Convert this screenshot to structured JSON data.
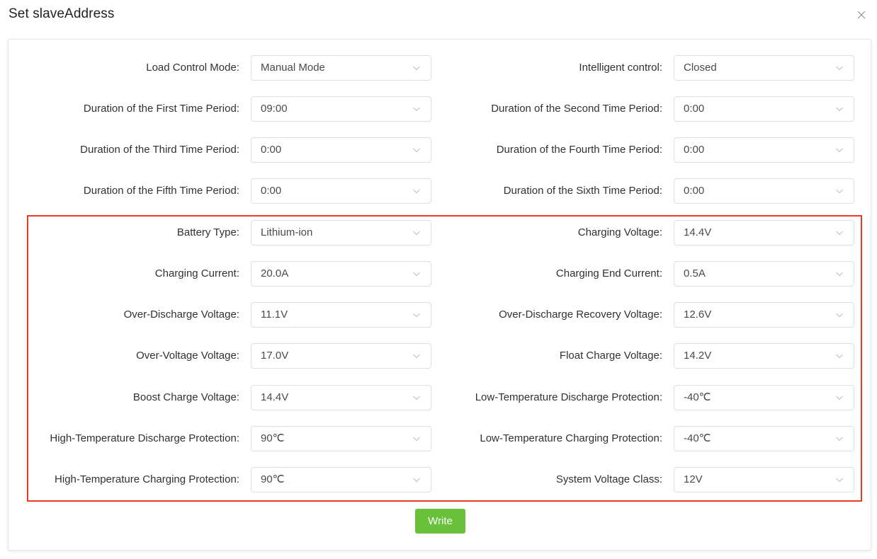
{
  "dialog": {
    "title": "Set slaveAddress"
  },
  "icons": {
    "close": "close-icon",
    "dropdown": "chevron-down-icon"
  },
  "colors": {
    "highlight": "#ee3a1e",
    "primary_button": "#67c23a"
  },
  "fields": [
    {
      "left": {
        "label": "Load Control Mode:",
        "value": "Manual Mode"
      },
      "right": {
        "label": "Intelligent control:",
        "value": "Closed"
      }
    },
    {
      "left": {
        "label": "Duration of the First Time Period:",
        "value": "09:00"
      },
      "right": {
        "label": "Duration of the Second Time Period:",
        "value": "0:00"
      }
    },
    {
      "left": {
        "label": "Duration of the Third Time Period:",
        "value": "0:00"
      },
      "right": {
        "label": "Duration of the Fourth Time Period:",
        "value": "0:00"
      }
    },
    {
      "left": {
        "label": "Duration of the Fifth Time Period:",
        "value": "0:00"
      },
      "right": {
        "label": "Duration of the Sixth Time Period:",
        "value": "0:00"
      }
    },
    {
      "left": {
        "label": "Battery Type:",
        "value": "Lithium-ion"
      },
      "right": {
        "label": "Charging Voltage:",
        "value": "14.4V"
      }
    },
    {
      "left": {
        "label": "Charging Current:",
        "value": "20.0A"
      },
      "right": {
        "label": "Charging End Current:",
        "value": "0.5A"
      }
    },
    {
      "left": {
        "label": "Over-Discharge Voltage:",
        "value": "11.1V"
      },
      "right": {
        "label": "Over-Discharge Recovery Voltage:",
        "value": "12.6V"
      }
    },
    {
      "left": {
        "label": "Over-Voltage Voltage:",
        "value": "17.0V"
      },
      "right": {
        "label": "Float Charge Voltage:",
        "value": "14.2V"
      }
    },
    {
      "left": {
        "label": "Boost Charge Voltage:",
        "value": "14.4V"
      },
      "right": {
        "label": "Low-Temperature Discharge Protection:",
        "value": "-40℃"
      }
    },
    {
      "left": {
        "label": "High-Temperature Discharge Protection:",
        "value": "90℃"
      },
      "right": {
        "label": "Low-Temperature Charging Protection:",
        "value": "-40℃"
      }
    },
    {
      "left": {
        "label": "High-Temperature Charging Protection:",
        "value": "90℃"
      },
      "right": {
        "label": "System Voltage Class:",
        "value": "12V"
      }
    }
  ],
  "actions": {
    "write_label": "Write"
  }
}
